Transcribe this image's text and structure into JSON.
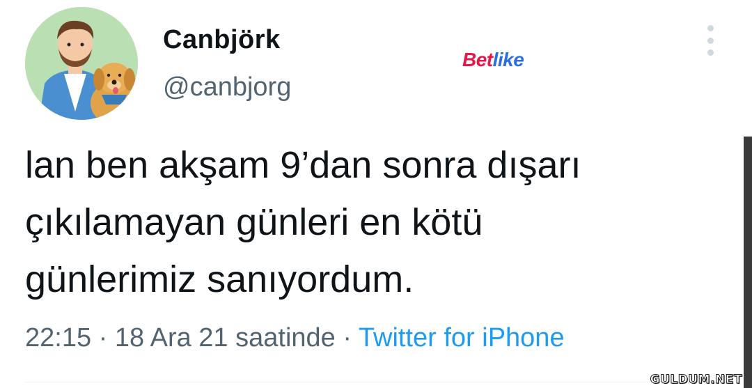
{
  "profile": {
    "display_name": "Canbjörk",
    "handle": "@canbjorg"
  },
  "watermark": {
    "logo_part1": "Bet",
    "logo_part2": "like",
    "site": "GULDUM.NET"
  },
  "tweet": {
    "text": "lan ben akşam 9’dan sonra dışarı\nçıkılamayan günleri en kötü\ngünlerimiz sanıyordum.",
    "time": "22:15",
    "date": "18 Ara 21 saatinde",
    "separator": " · ",
    "source": "Twitter for iPhone"
  },
  "icons": {
    "more": "more-vertical-icon"
  },
  "colors": {
    "text": "#0f1419",
    "muted": "#536471",
    "link": "#1d9bf0",
    "avatar_bg": "#b9dfb2"
  }
}
